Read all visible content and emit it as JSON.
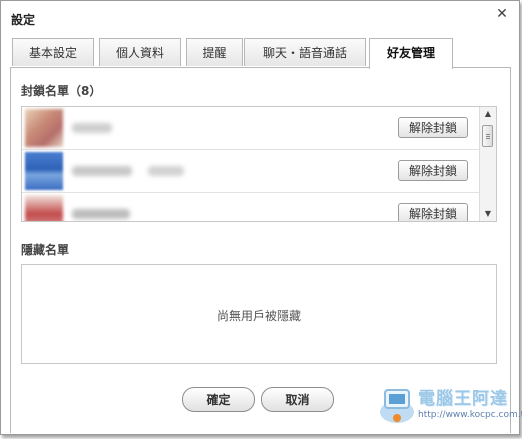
{
  "window": {
    "title": "設定"
  },
  "tabs": [
    {
      "label": "基本設定"
    },
    {
      "label": "個人資料"
    },
    {
      "label": "提醒"
    },
    {
      "label": "聊天・語音通話"
    },
    {
      "label": "好友管理"
    }
  ],
  "active_tab": "好友管理",
  "blocked": {
    "heading": "封鎖名單（8）",
    "rows": [
      {
        "button": "解除封鎖"
      },
      {
        "button": "解除封鎖"
      },
      {
        "button": "解除封鎖"
      }
    ]
  },
  "hidden": {
    "heading": "隱藏名單",
    "empty_text": "尚無用戶被隱藏"
  },
  "footer": {
    "ok": "確定",
    "cancel": "取消"
  },
  "watermark": {
    "text": "電腦王阿達",
    "url": "http://www.kocpc.com.tw"
  }
}
